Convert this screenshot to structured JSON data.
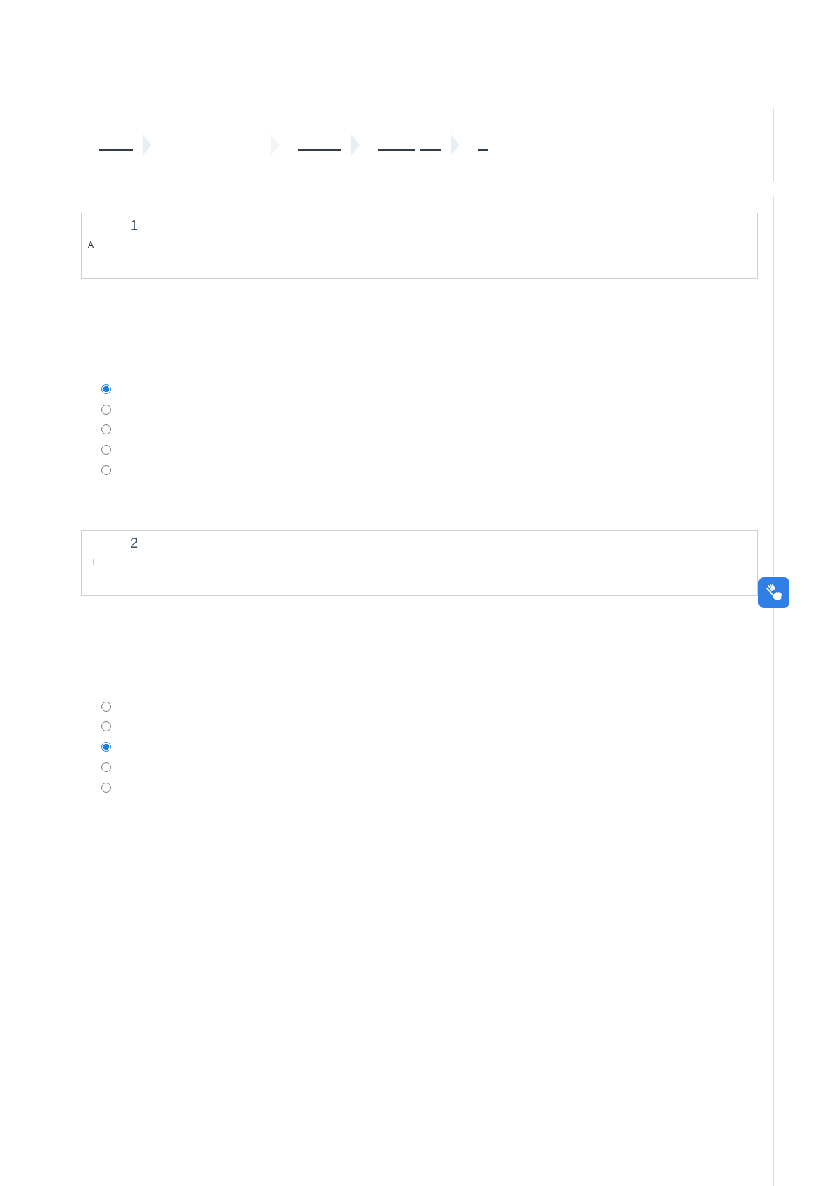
{
  "breadcrumb": [
    {
      "kind": "link"
    },
    {
      "kind": "blank"
    },
    {
      "kind": "link"
    },
    {
      "kind": "link2"
    },
    {
      "kind": "short"
    }
  ],
  "questions": [
    {
      "number": "1",
      "text": "A",
      "options": [
        {
          "selected": true
        },
        {
          "selected": false
        },
        {
          "selected": false
        },
        {
          "selected": false
        },
        {
          "selected": false
        }
      ]
    },
    {
      "number": "2",
      "text": "i",
      "options": [
        {
          "selected": false
        },
        {
          "selected": false
        },
        {
          "selected": true
        },
        {
          "selected": false
        },
        {
          "selected": false
        }
      ]
    }
  ]
}
